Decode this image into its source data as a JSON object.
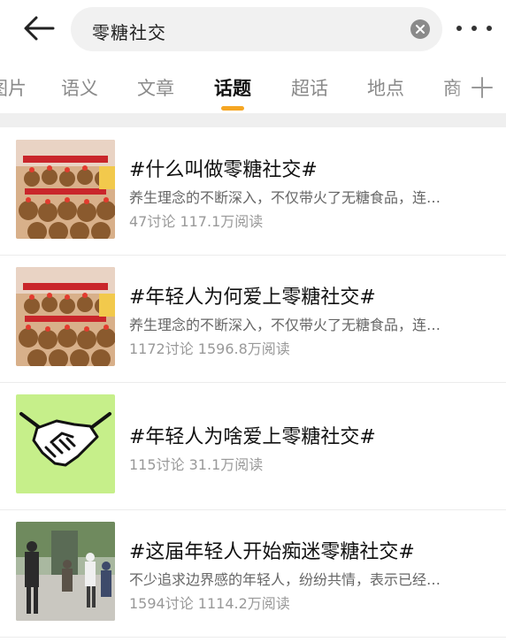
{
  "search": {
    "query": "零糖社交"
  },
  "tabs": [
    {
      "label": "图片"
    },
    {
      "label": "语义"
    },
    {
      "label": "文章"
    },
    {
      "label": "话题"
    },
    {
      "label": "超话"
    },
    {
      "label": "地点"
    },
    {
      "label": "商"
    }
  ],
  "active_tab": "话题",
  "accent_color": "#f5a623",
  "topics": [
    {
      "title": "#什么叫做零糖社交#",
      "description": "养生理念的不断深入，不仅带火了无糖食品，连…",
      "stats": "47讨论 117.1万阅读",
      "thumb": "plush-toys-photo"
    },
    {
      "title": "#年轻人为何爱上零糖社交#",
      "description": "养生理念的不断深入，不仅带火了无糖食品，连…",
      "stats": "1172讨论 1596.8万阅读",
      "thumb": "plush-toys-photo"
    },
    {
      "title": "#年轻人为啥爱上零糖社交#",
      "description": "",
      "stats": "115讨论 31.1万阅读",
      "thumb": "handshake-icon"
    },
    {
      "title": "#这届年轻人开始痴迷零糖社交#",
      "description": "不少追求边界感的年轻人，纷纷共情，表示已经…",
      "stats": "1594讨论 1114.2万阅读",
      "thumb": "people-outdoor-photo"
    }
  ]
}
